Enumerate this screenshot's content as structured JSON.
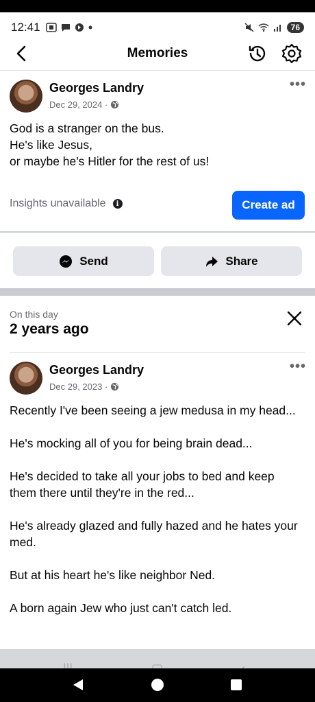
{
  "status_bar": {
    "time": "12:41",
    "battery": "76"
  },
  "header": {
    "title": "Memories"
  },
  "post1": {
    "author": "Georges Landry",
    "date": "Dec 29, 2024 ·",
    "text": "God is a stranger on the bus.\nHe's like Jesus,\nor maybe he's Hitler for the rest of us!",
    "insights_label": "Insights unavailable",
    "create_ad_label": "Create ad"
  },
  "actions": {
    "send_label": "Send",
    "share_label": "Share"
  },
  "memory": {
    "on_this_day": "On this day",
    "years_ago": "2 years ago"
  },
  "post2": {
    "author": "Georges Landry",
    "date": "Dec 29, 2023 ·",
    "text": "Recently I've been seeing a jew medusa in my head...\n\nHe's mocking all of you for being brain dead...\n\nHe's decided to take all your jobs to bed and keep them there until they're in the red...\n\nHe's already glazed and fully hazed and he hates your med.\n\nBut at his heart he's like neighbor Ned.\n\nA born again Jew who just can't catch led."
  },
  "colors": {
    "accent": "#0866ff",
    "button_gray": "#e4e6eb",
    "secondary_text": "#65676b"
  }
}
